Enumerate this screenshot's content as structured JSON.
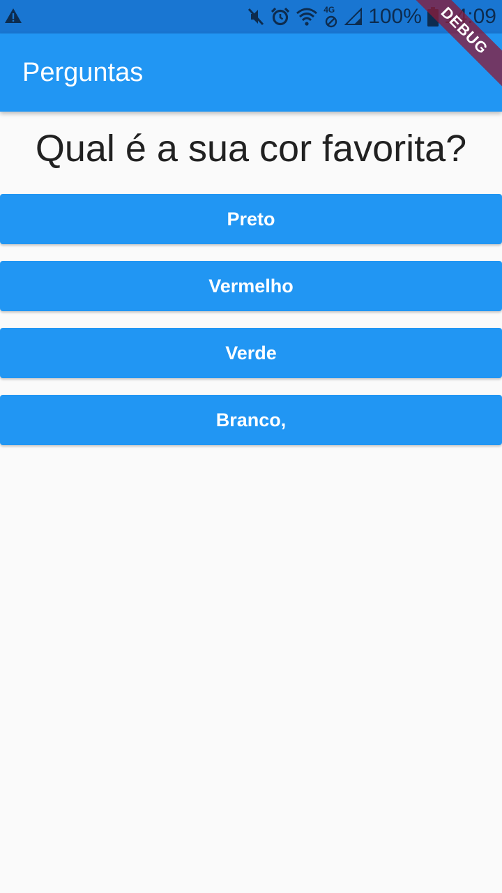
{
  "status_bar": {
    "battery": "100%",
    "time": "14:09",
    "network": "4G",
    "icons": [
      "warning-icon",
      "mute-icon",
      "alarm-icon",
      "wifi-icon",
      "no-sim-icon",
      "signal-icon",
      "battery-icon"
    ]
  },
  "app_bar": {
    "title": "Perguntas"
  },
  "debug_banner": "DEBUG",
  "question": "Qual é a sua cor favorita?",
  "answers": [
    {
      "label": "Preto"
    },
    {
      "label": "Vermelho"
    },
    {
      "label": "Verde"
    },
    {
      "label": "Branco,"
    }
  ],
  "colors": {
    "primary": "#2196f3",
    "primary_dark": "#1976d2",
    "background": "#fafafa",
    "text": "#212121"
  }
}
